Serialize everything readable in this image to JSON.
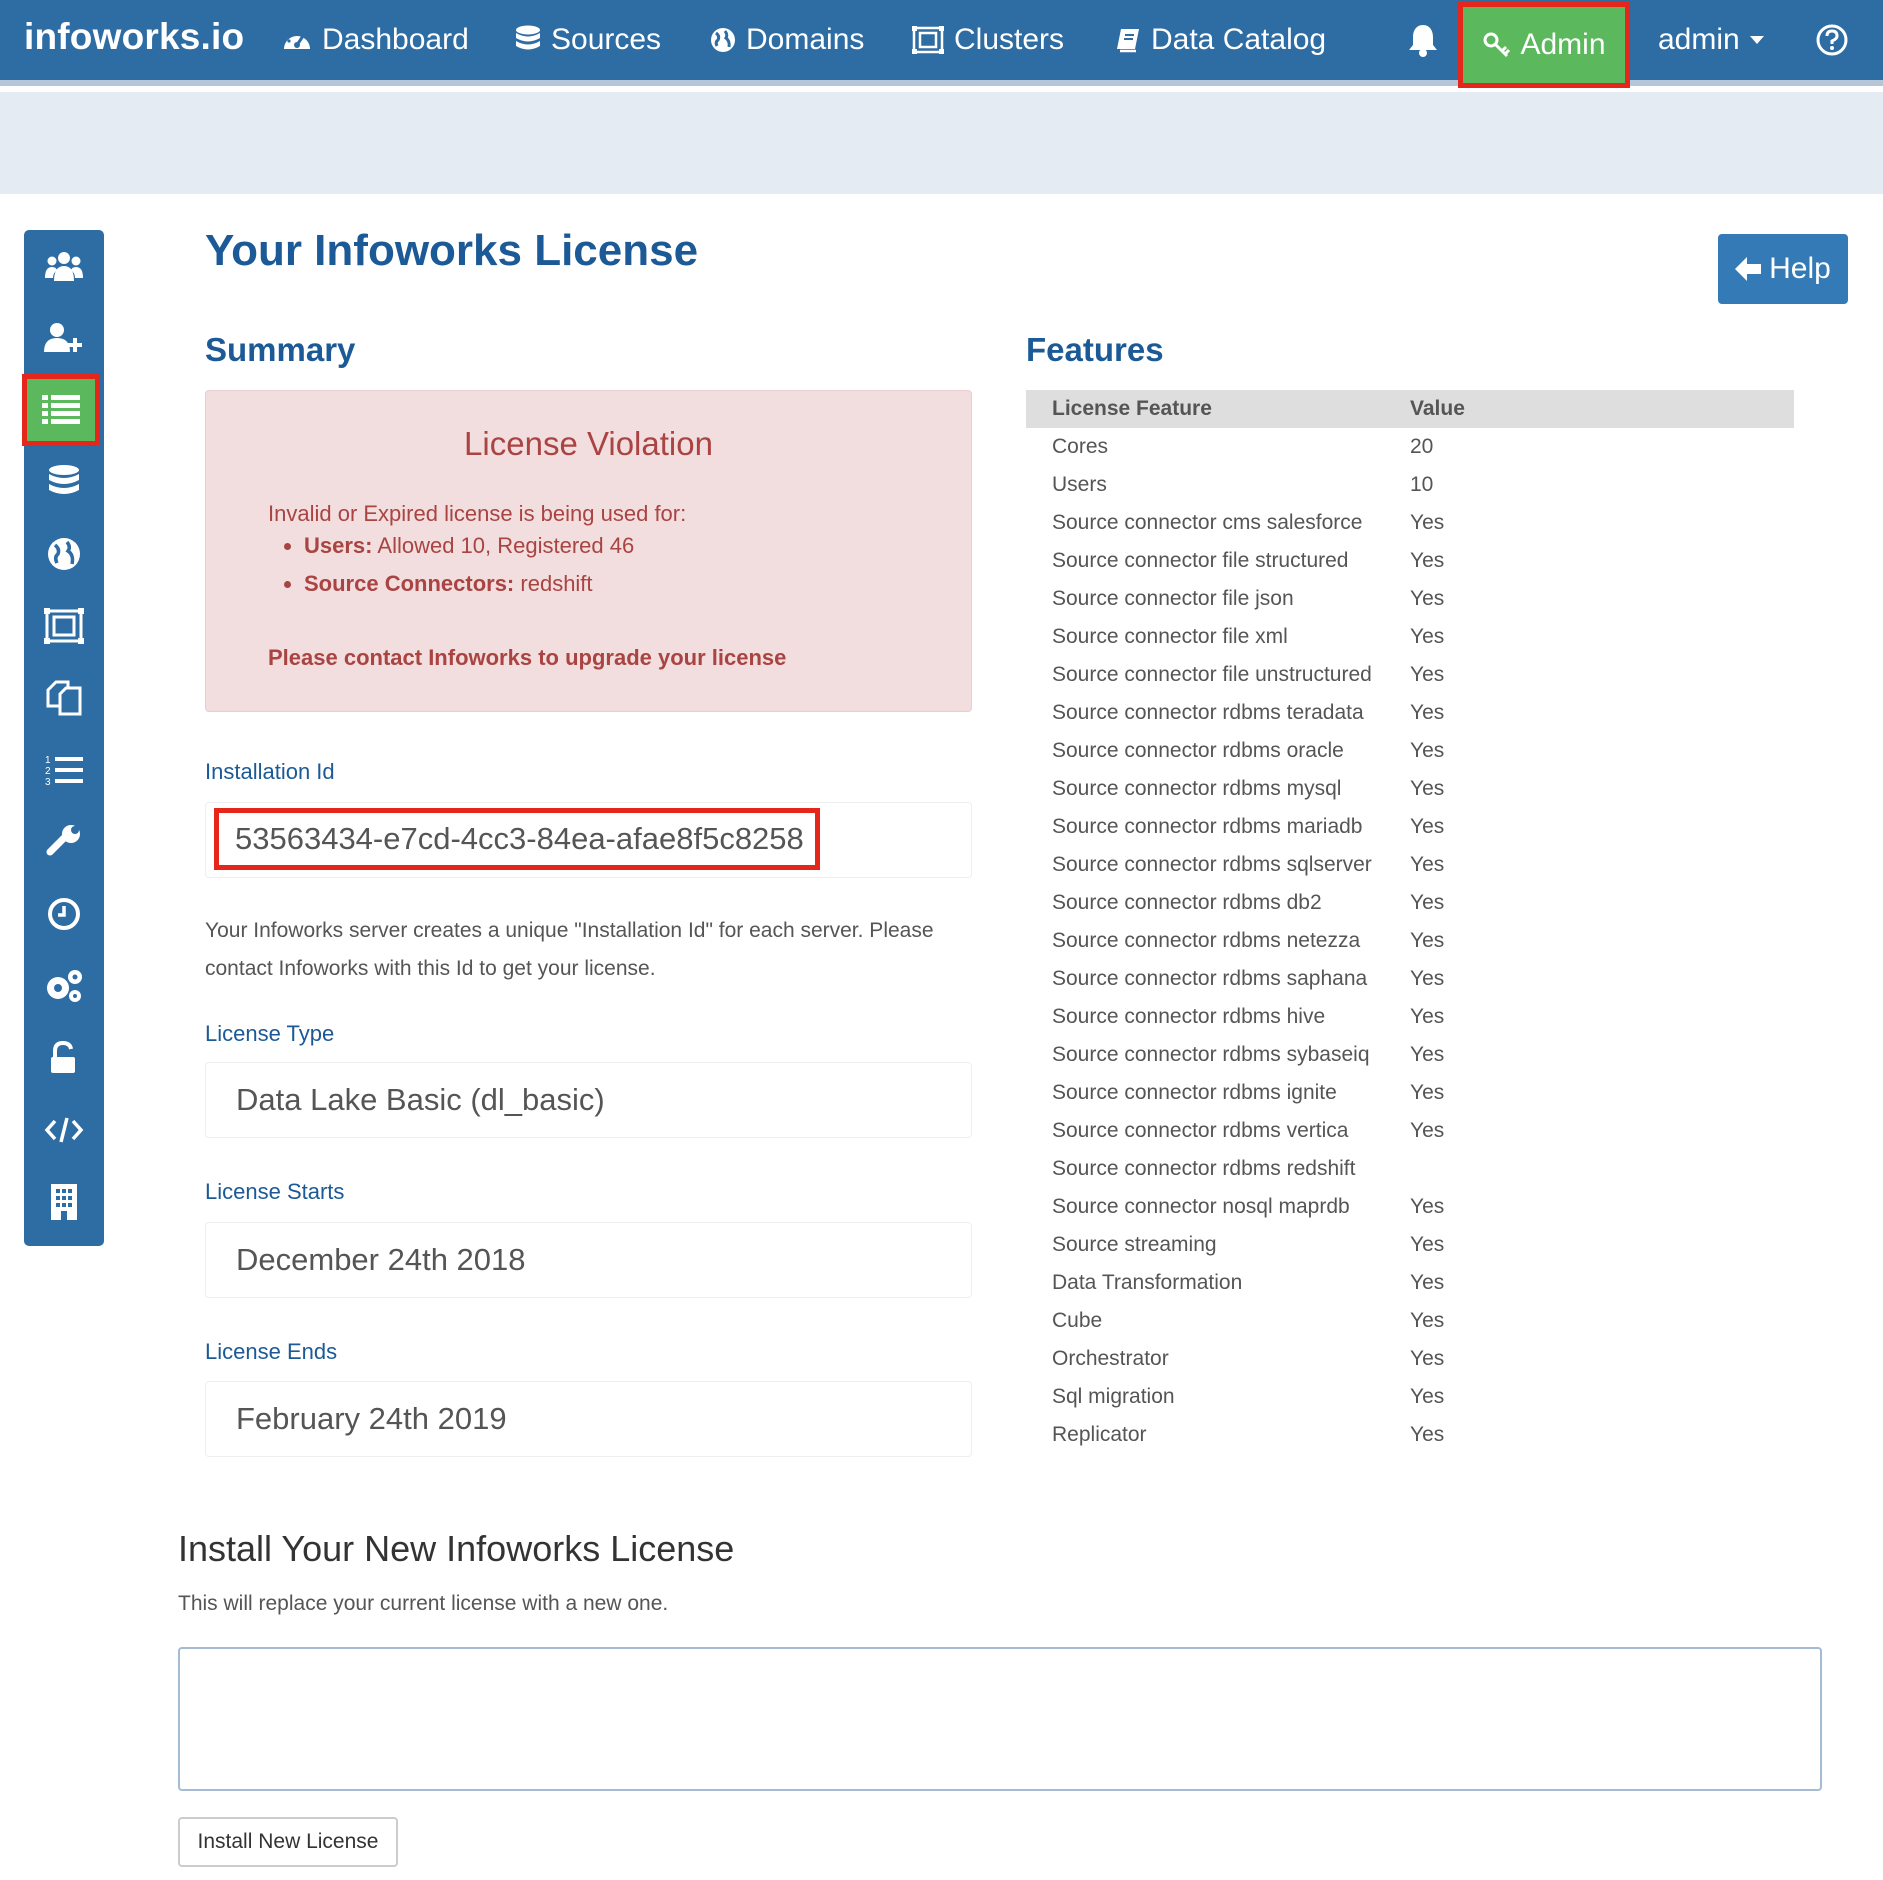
{
  "app": {
    "brand": "infoworks.io"
  },
  "topnav": {
    "items": [
      {
        "label": "Dashboard",
        "icon": "dashboard-icon"
      },
      {
        "label": "Sources",
        "icon": "database-icon"
      },
      {
        "label": "Domains",
        "icon": "globe-icon"
      },
      {
        "label": "Clusters",
        "icon": "cluster-icon"
      },
      {
        "label": "Data Catalog",
        "icon": "book-icon"
      }
    ],
    "bell_icon": "bell-icon",
    "admin_label": "Admin",
    "user_label": "admin",
    "help_icon": "question-circle-icon",
    "colors": {
      "bar": "#2e6ca4",
      "active": "#5cb85c",
      "highlight": "#e5261b"
    }
  },
  "sidebar": {
    "items": [
      {
        "icon": "users-icon"
      },
      {
        "icon": "add-user-icon"
      },
      {
        "icon": "list-icon",
        "active": true
      },
      {
        "icon": "database-icon"
      },
      {
        "icon": "globe-icon"
      },
      {
        "icon": "cluster-icon"
      },
      {
        "icon": "copy-icon"
      },
      {
        "icon": "ordered-list-icon"
      },
      {
        "icon": "wrench-icon"
      },
      {
        "icon": "clock-icon"
      },
      {
        "icon": "gears-icon"
      },
      {
        "icon": "unlock-icon"
      },
      {
        "icon": "code-icon"
      },
      {
        "icon": "building-icon"
      }
    ]
  },
  "page": {
    "title": "Your Infoworks License",
    "help_label": "Help"
  },
  "summary": {
    "heading": "Summary",
    "violation": {
      "title": "License Violation",
      "text": "Invalid or Expired license is being used for:",
      "items": [
        {
          "label": "Users:",
          "value": "Allowed 10, Registered 46"
        },
        {
          "label": "Source Connectors:",
          "value": "redshift"
        }
      ],
      "contact": "Please contact Infoworks to upgrade your license"
    },
    "installation_id_label": "Installation Id",
    "installation_id": "53563434-e7cd-4cc3-84ea-afae8f5c8258",
    "installation_note": "Your Infoworks server creates a unique \"Installation Id\" for each server. Please contact Infoworks with this Id to get your license.",
    "license_type_label": "License Type",
    "license_type": "Data Lake Basic (dl_basic)",
    "license_starts_label": "License Starts",
    "license_starts": "December 24th 2018",
    "license_ends_label": "License Ends",
    "license_ends": "February 24th 2019"
  },
  "features": {
    "heading": "Features",
    "columns": [
      "License Feature",
      "Value"
    ],
    "rows": [
      {
        "feature": "Cores",
        "value": "20"
      },
      {
        "feature": "Users",
        "value": "10"
      },
      {
        "feature": "Source connector cms salesforce",
        "value": "Yes"
      },
      {
        "feature": "Source connector file structured",
        "value": "Yes"
      },
      {
        "feature": "Source connector file json",
        "value": "Yes"
      },
      {
        "feature": "Source connector file xml",
        "value": "Yes"
      },
      {
        "feature": "Source connector file unstructured",
        "value": "Yes"
      },
      {
        "feature": "Source connector rdbms teradata",
        "value": "Yes"
      },
      {
        "feature": "Source connector rdbms oracle",
        "value": "Yes"
      },
      {
        "feature": "Source connector rdbms mysql",
        "value": "Yes"
      },
      {
        "feature": "Source connector rdbms mariadb",
        "value": "Yes"
      },
      {
        "feature": "Source connector rdbms sqlserver",
        "value": "Yes"
      },
      {
        "feature": "Source connector rdbms db2",
        "value": "Yes"
      },
      {
        "feature": "Source connector rdbms netezza",
        "value": "Yes"
      },
      {
        "feature": "Source connector rdbms saphana",
        "value": "Yes"
      },
      {
        "feature": "Source connector rdbms hive",
        "value": "Yes"
      },
      {
        "feature": "Source connector rdbms sybaseiq",
        "value": "Yes"
      },
      {
        "feature": "Source connector rdbms ignite",
        "value": "Yes"
      },
      {
        "feature": "Source connector rdbms vertica",
        "value": "Yes"
      },
      {
        "feature": "Source connector rdbms redshift",
        "value": ""
      },
      {
        "feature": "Source connector nosql maprdb",
        "value": "Yes"
      },
      {
        "feature": "Source streaming",
        "value": "Yes"
      },
      {
        "feature": "Data Transformation",
        "value": "Yes"
      },
      {
        "feature": "Cube",
        "value": "Yes"
      },
      {
        "feature": "Orchestrator",
        "value": "Yes"
      },
      {
        "feature": "Sql migration",
        "value": "Yes"
      },
      {
        "feature": "Replicator",
        "value": "Yes"
      }
    ]
  },
  "install": {
    "title": "Install Your New Infoworks License",
    "subtitle": "This will replace your current license with a new one.",
    "textarea_value": "",
    "button_label": "Install New License"
  }
}
